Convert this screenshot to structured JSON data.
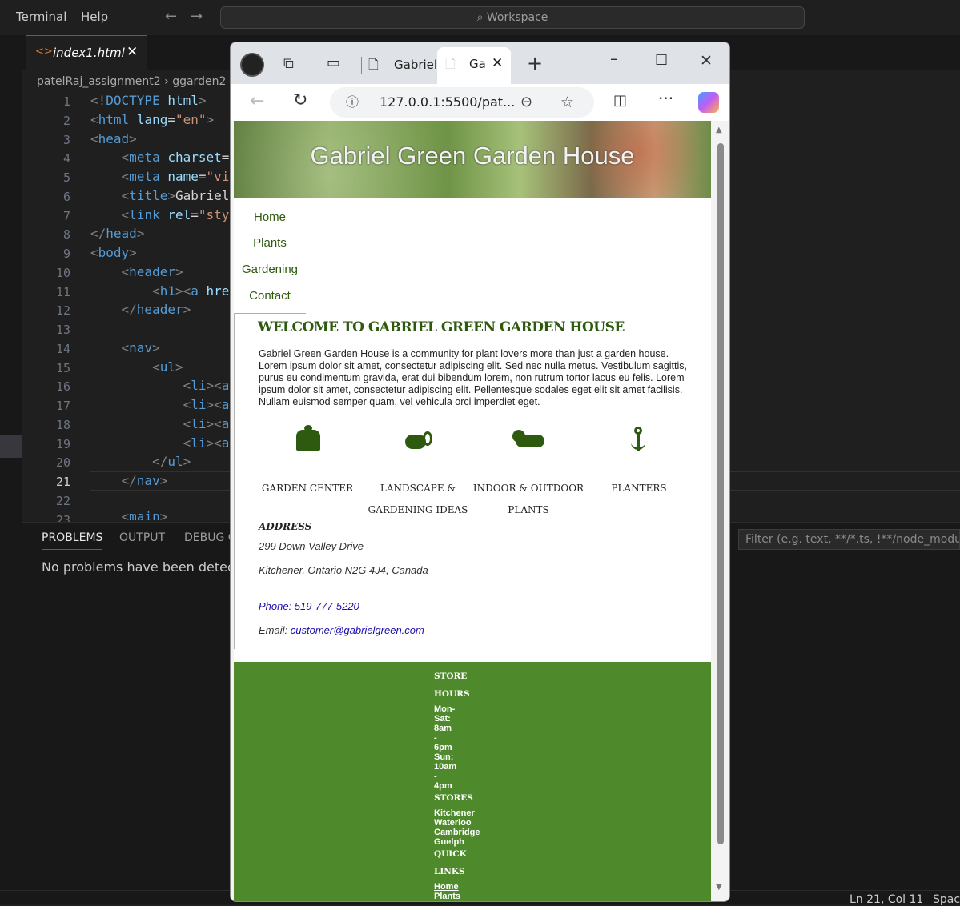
{
  "vscode": {
    "menu": [
      "Terminal",
      "Help"
    ],
    "search_placeholder": "Workspace",
    "tab_label": "index1.html",
    "breadcrumb": [
      "patelRaj_assignment2",
      "ggarden2"
    ],
    "line_numbers": [
      "1",
      "2",
      "3",
      "4",
      "5",
      "6",
      "7",
      "8",
      "9",
      "10",
      "11",
      "12",
      "13",
      "14",
      "15",
      "16",
      "17",
      "18",
      "19",
      "20",
      "21",
      "22",
      "23"
    ],
    "panel_tabs": [
      "PROBLEMS",
      "OUTPUT",
      "DEBUG C"
    ],
    "panel_message": "No problems have been detected",
    "filter_placeholder": "Filter (e.g. text, **/*.ts, !**/node_modules",
    "status_position": "Ln 21, Col 11",
    "status_spaces": "Spac"
  },
  "browser": {
    "tab1_title": "Gabriel",
    "tab2_title": "Ga",
    "url": "127.0.0.1:5500/pat...",
    "page": {
      "site_title": "Gabriel Green Garden House",
      "nav": [
        "Home",
        "Plants",
        "Gardening",
        "Contact"
      ],
      "welcome_heading": "WELCOME TO GABRIEL GREEN GARDEN HOUSE",
      "intro": "Gabriel Green Garden House is a community for plant lovers more than just a garden house. Lorem ipsum dolor sit amet, consectetur adipiscing elit. Sed nec nulla metus. Vestibulum sagittis, purus eu condimentum gravida, erat dui bibendum lorem, non rutrum tortor lacus eu felis. Lorem ipsum dolor sit amet, consectetur adipiscing elit. Pellentesque sodales eget elit sit amet facilisis. Nullam euismod semper quam, vel vehicula orci imperdiet eget.",
      "services": [
        {
          "label": "GARDEN CENTER",
          "icon": "chess-piece-icon"
        },
        {
          "label": "LANDSCAPE & GARDENING IDEAS",
          "icon": "watering-can-icon"
        },
        {
          "label": "INDOOR & OUTDOOR PLANTS",
          "icon": "cloud-sun-icon"
        },
        {
          "label": "PLANTERS",
          "icon": "plant-anchor-icon"
        }
      ],
      "address_heading": "ADDRESS",
      "street": "299 Down Valley Drive",
      "city": "Kitchener, Ontario N2G 4J4, Canada",
      "phone": "Phone: 519-777-5220",
      "email_label": "Email:",
      "email": "customer@gabrielgreen.com",
      "footer": {
        "store_hours_heading_1": "STORE",
        "store_hours_heading_2": "HOURS",
        "hours_lines": [
          "Mon-",
          "Sat:",
          "8am",
          "-",
          "6pm",
          "Sun:",
          "10am",
          "-",
          "4pm"
        ],
        "stores_heading": "STORES",
        "stores": [
          "Kitchener",
          "Waterloo",
          "Cambridge",
          "Guelph"
        ],
        "quick_links_heading_1": "QUICK",
        "quick_links_heading_2": "LINKS",
        "quick_links": [
          "Home",
          "Plants"
        ]
      }
    }
  },
  "colors": {
    "accent_green": "#2e5a0f",
    "footer_green": "#4e8a2b",
    "vscode_accent": "#0078d4"
  }
}
